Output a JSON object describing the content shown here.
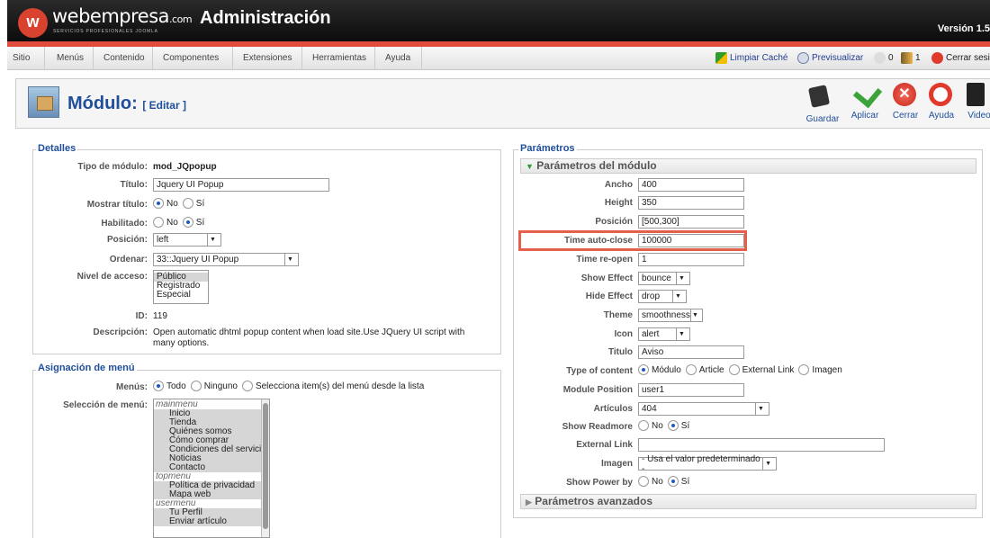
{
  "header": {
    "logo_letter": "w",
    "logo_text": "webempresa",
    "logo_com": ".com",
    "logo_sub": "SERVICIOS PROFESIONALES JOOMLA",
    "title": "Administración",
    "version": "Versión 1.5"
  },
  "menubar": {
    "items": [
      "Sitio",
      "Menús",
      "Contenido",
      "Componentes",
      "Extensiones",
      "Herramientas",
      "Ayuda"
    ],
    "clear_cache": "Limpiar Caché",
    "preview": "Previsualizar",
    "messages_count": "0",
    "users_count": "1",
    "logout": "Cerrar sesi"
  },
  "toolbar": {
    "title": "Módulo:",
    "subtitle": "[ Editar ]",
    "buttons": [
      "Guardar",
      "Aplicar",
      "Cerrar",
      "Ayuda",
      "Video"
    ]
  },
  "details": {
    "legend": "Detalles",
    "module_type_label": "Tipo de módulo:",
    "module_type": "mod_JQpopup",
    "title_label": "Título:",
    "title_value": "Jquery UI Popup",
    "show_title_label": "Mostrar título:",
    "no": "No",
    "yes": "Sí",
    "enabled_label": "Habilitado:",
    "position_label": "Posición:",
    "position_value": "left",
    "order_label": "Ordenar:",
    "order_value": "33::Jquery UI Popup",
    "access_label": "Nivel de acceso:",
    "access_options": [
      "Público",
      "Registrado",
      "Especial"
    ],
    "id_label": "ID:",
    "id_value": "119",
    "desc_label": "Descripción:",
    "desc_value": "Open automatic dhtml popup content when load site.Use JQuery UI script with many options."
  },
  "menu_assign": {
    "legend": "Asignación de menú",
    "menus_label": "Menús:",
    "opt_all": "Todo",
    "opt_none": "Ninguno",
    "opt_select": "Selecciona item(s) del menú desde la lista",
    "selection_label": "Selección de menú:",
    "list": [
      {
        "type": "grp",
        "text": "mainmenu"
      },
      {
        "type": "sub",
        "text": "Inicio"
      },
      {
        "type": "sub",
        "text": "Tienda"
      },
      {
        "type": "sub",
        "text": "Quiénes somos"
      },
      {
        "type": "sub",
        "text": "Cómo comprar"
      },
      {
        "type": "sub",
        "text": "Condiciones del servicio"
      },
      {
        "type": "sub",
        "text": "Noticias"
      },
      {
        "type": "sub",
        "text": "Contacto"
      },
      {
        "type": "grp",
        "text": "topmenu"
      },
      {
        "type": "sub",
        "text": "Política de privacidad"
      },
      {
        "type": "sub",
        "text": "Mapa web"
      },
      {
        "type": "grp",
        "text": "usermenu"
      },
      {
        "type": "sub",
        "text": "Tu Perfil"
      },
      {
        "type": "sub",
        "text": "Enviar artículo"
      }
    ]
  },
  "params": {
    "legend": "Parámetros",
    "module_params": "Parámetros del módulo",
    "advanced_params": "Parámetros avanzados",
    "ancho_label": "Ancho",
    "ancho": "400",
    "height_label": "Height",
    "height": "350",
    "posicion_label": "Posición",
    "posicion": "[500,300]",
    "autoclose_label": "Time auto-close",
    "autoclose": "100000",
    "reopen_label": "Time re-open",
    "reopen": "1",
    "show_effect_label": "Show Effect",
    "show_effect": "bounce",
    "hide_effect_label": "Hide Effect",
    "hide_effect": "drop",
    "theme_label": "Theme",
    "theme": "smoothness",
    "icon_label": "Icon",
    "icon": "alert",
    "titulo_label": "Titulo",
    "titulo": "Aviso",
    "content_type_label": "Type of content",
    "content_types": [
      "Módulo",
      "Article",
      "External Link",
      "Imagen"
    ],
    "module_position_label": "Module Position",
    "module_position": "user1",
    "articulos_label": "Artículos",
    "articulos": "404",
    "readmore_label": "Show Readmore",
    "external_link_label": "External Link",
    "external_link": "",
    "imagen_label": "Imagen",
    "imagen": "- Usa el valor predeterminado -",
    "power_label": "Show Power by",
    "no": "No",
    "yes": "Sí"
  }
}
